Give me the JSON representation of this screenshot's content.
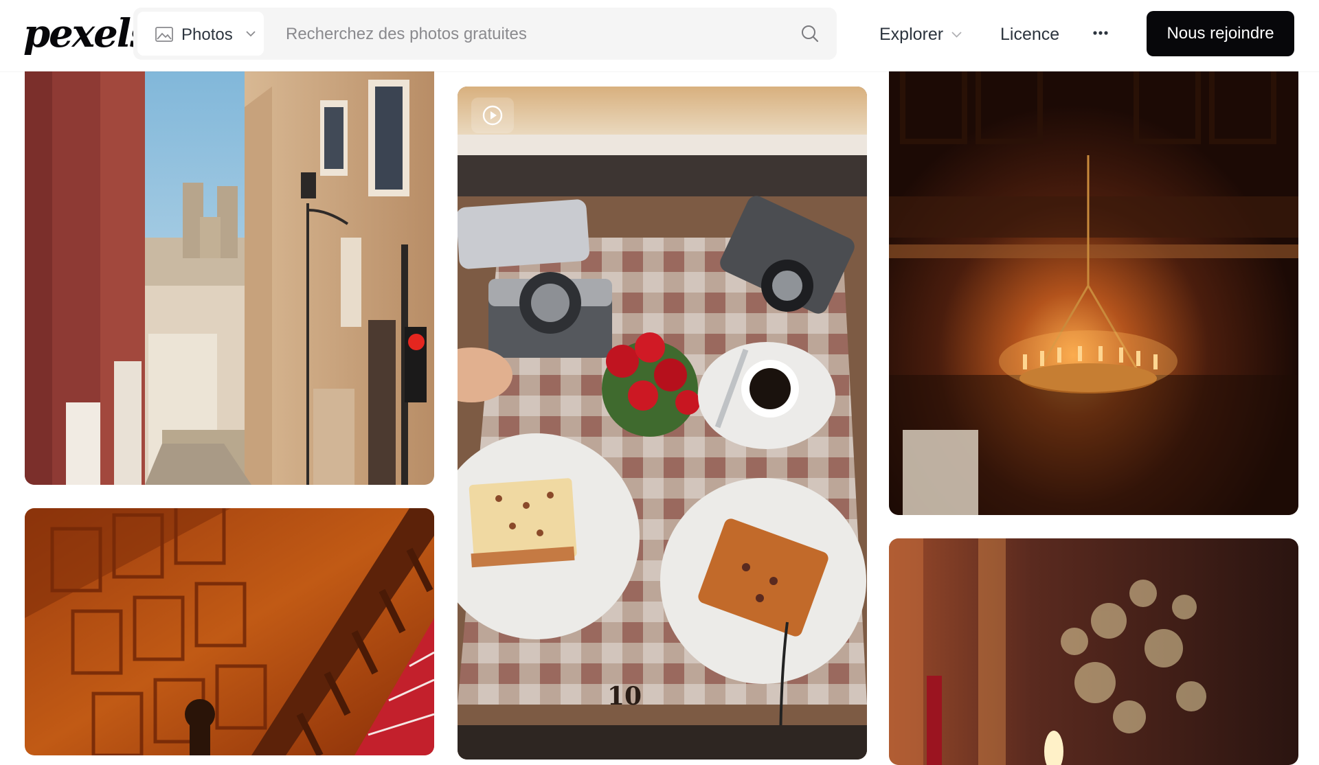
{
  "header": {
    "logo": "pexels",
    "search": {
      "type_label": "Photos",
      "placeholder": "Recherchez des photos gratuites",
      "value": ""
    },
    "nav": {
      "explorer": "Explorer",
      "licence": "Licence"
    },
    "join_label": "Nous rejoindre"
  },
  "colors": {
    "brand_dark": "#07070a",
    "search_bg": "#f5f5f5",
    "placeholder": "#8a8a8e"
  },
  "icons": [
    "image-icon",
    "chevron-down-icon",
    "search-icon",
    "more-dots-icon",
    "video-play-icon"
  ],
  "photos": [
    {
      "subject": "street-alley"
    },
    {
      "subject": "wooden-staircase"
    },
    {
      "subject": "cafe-table"
    },
    {
      "subject": "chandelier"
    },
    {
      "subject": "candle-bokeh"
    }
  ],
  "cafe_table_number": "10"
}
